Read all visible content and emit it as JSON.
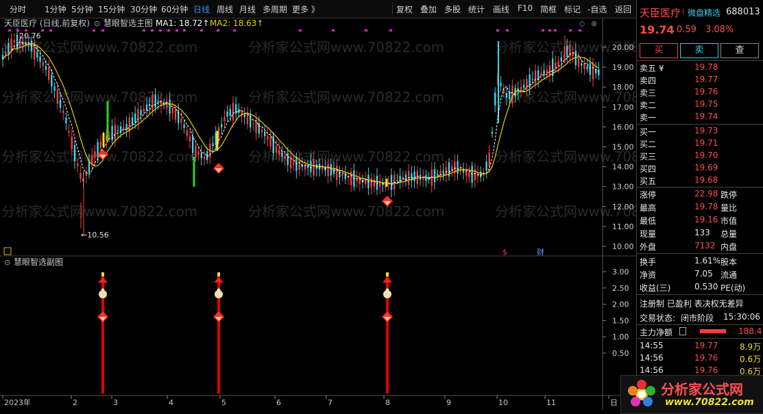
{
  "toolbar": {
    "periods": [
      "分时",
      "1分钟",
      "5分钟",
      "15分钟",
      "30分钟",
      "60分钟",
      "日线",
      "周线",
      "月线",
      "多周期",
      "更多 》"
    ],
    "active_period": "日线",
    "actions": [
      "复权",
      "叠加",
      "多股",
      "统计",
      "画线",
      "F10",
      "简框",
      "标记",
      "-自选",
      "返回"
    ]
  },
  "main_chart": {
    "info_title": "天臣医疗 (日线,前复权)",
    "indicator_name": "慧眼智选主图",
    "ma1_label": "MA1: 18.72↑",
    "ma2_label": "MA2: 18.63↑",
    "high_marker": "20.76",
    "low_marker": "←10.56",
    "y_ticks": [
      "20.00",
      "19.00",
      "18.00",
      "17.00",
      "16.00",
      "15.00",
      "14.00",
      "13.00",
      "12.00",
      "11.00",
      "10.00"
    ],
    "event_markers": [
      "$",
      "财"
    ],
    "watermark": "分析家公式网www.70822.com"
  },
  "sub_chart": {
    "title": "慧眼智选副图",
    "y_ticks": [
      "3.00",
      "2.50",
      "2.00",
      "1.50",
      "1.00",
      "0.50"
    ]
  },
  "x_axis": {
    "labels": [
      "2023年",
      "2",
      "3",
      "4",
      "5",
      "6",
      "7",
      "8",
      "9",
      "10",
      "11",
      "日"
    ]
  },
  "quote": {
    "name": "天臣医疗",
    "tag": "微盘精选",
    "code": "688013",
    "price": "19.74",
    "change": "0.59",
    "change_pct": "3.08%",
    "buttons": {
      "buy": "买",
      "sell": "卖",
      "query": "查"
    },
    "sells": [
      {
        "label": "卖五 ¥",
        "price": "19.78"
      },
      {
        "label": "卖四",
        "price": "19.77"
      },
      {
        "label": "卖三",
        "price": "19.76"
      },
      {
        "label": "卖二",
        "price": "19.75"
      },
      {
        "label": "卖一",
        "price": "19.74"
      }
    ],
    "buys": [
      {
        "label": "买一",
        "price": "19.73"
      },
      {
        "label": "买二",
        "price": "19.71"
      },
      {
        "label": "买三",
        "price": "19.70"
      },
      {
        "label": "买四",
        "price": "19.69"
      },
      {
        "label": "买五",
        "price": "19.68"
      }
    ],
    "stats": [
      {
        "l1": "涨停",
        "v1": "22.98",
        "l2": "跌停"
      },
      {
        "l1": "最高",
        "v1": "19.78",
        "l2": "量比"
      },
      {
        "l1": "最低",
        "v1": "19.16",
        "l2": "市值"
      },
      {
        "l1": "现量",
        "v1": "133",
        "l2": "总量"
      },
      {
        "l1": "外盘",
        "v1": "7132",
        "l2": "内盘"
      }
    ],
    "stats2": [
      {
        "l1": "换手",
        "v1": "1.61%",
        "l2": "股本"
      },
      {
        "l1": "净资",
        "v1": "7.05",
        "l2": "流通"
      },
      {
        "l1": "收益(三)",
        "v1": "0.530",
        "l2": "PE(动)"
      }
    ],
    "notes": "注册制 已盈利 表决权无差异",
    "trade_status_label": "交易状态:",
    "trade_status": "闭市阶段",
    "trade_time": "15:30:06",
    "main_net_label": "主力净额",
    "main_net_value": "188.4",
    "ticks": [
      {
        "time": "14:55",
        "price": "19.77",
        "vol": "8.9万"
      },
      {
        "time": "14:56",
        "price": "19.76",
        "vol": "0.6万"
      },
      {
        "time": "14:56",
        "price": "19.76",
        "vol": "0.6万"
      }
    ]
  },
  "logo": {
    "text": "分析家公式网",
    "url": "www.70822.com"
  },
  "colors": {
    "up": "#ff3b3b",
    "down": "#36d8ee",
    "ma1": "#ffffff",
    "ma2": "#e8d200",
    "signal_bar": "#e00000",
    "magenta_dots": "#e020e0"
  }
}
